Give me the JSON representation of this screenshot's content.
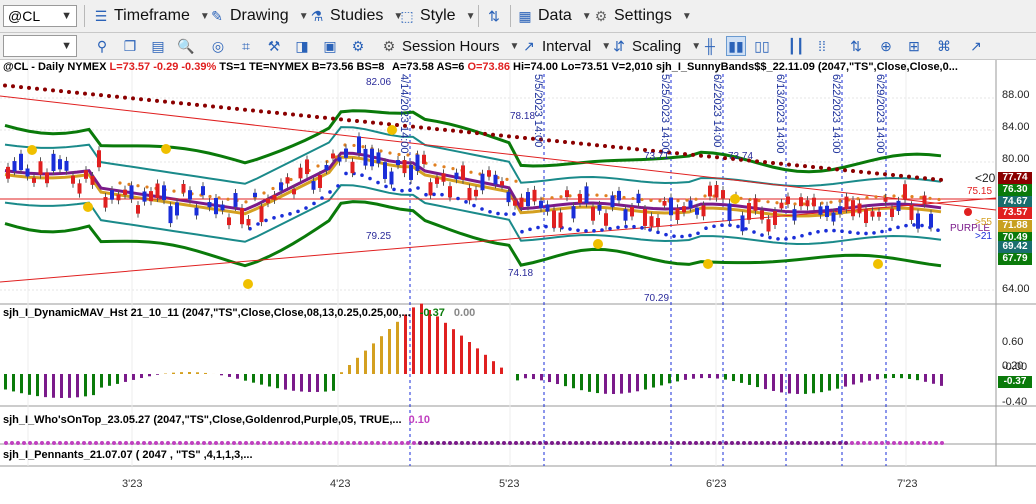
{
  "toolbar1": {
    "symbol": "@CL",
    "timeframe": "Timeframe",
    "drawing": "Drawing",
    "studies": "Studies",
    "style": "Style",
    "data": "Data",
    "settings": "Settings"
  },
  "toolbar2": {
    "combo_value": "",
    "session_hours": "Session Hours",
    "interval": "Interval",
    "scaling": "Scaling"
  },
  "header": {
    "symbol_line": "@CL - Daily  NYMEX",
    "L": "L=73.57",
    "chg": "-0.29",
    "pct": "-0.39%",
    "rest1": "TS=1  TE=NYMEX  B=73.56  BS=8",
    "rest2": "A=73.58  AS=6",
    "O": "O=73.86",
    "rest3": "Hi=74.00  Lo=73.51  V=2,010",
    "study": "sjh_I_SunnyBands$$_22.11.09 (2047,\"TS\",Close,Close,0..."
  },
  "annotations": {
    "v1": "4/14/2023 14:00",
    "v2": "5/5/2023 14:00",
    "v3": "5/25/2023 14:00",
    "v4": "6/2/2023 14:00",
    "v5": "6/13/2023 14:00",
    "v6": "6/22/2023 14:00",
    "v7": "6/29/2023 14:00",
    "p1": "82.06",
    "p2": "78.18",
    "p3": "73.71",
    "p4": "73.74",
    "p5": "79.25",
    "p6": "74.18",
    "p7": "70.29"
  },
  "price_scale": [
    "88.00",
    "84.00",
    "80.00",
    "64.00"
  ],
  "tags": [
    {
      "text": "77.74",
      "color": "#8b0000"
    },
    {
      "text": "76.30",
      "color": "#0a7a0a"
    },
    {
      "text": "74.67",
      "color": "#1a6e6e"
    },
    {
      "text": "73.57",
      "color": "#e02020"
    },
    {
      "text": "71.88",
      "color": "#c8a020"
    },
    {
      "text": "70.49",
      "color": "#0a7a0a"
    },
    {
      "text": "69.42",
      "color": "#1a6e6e"
    },
    {
      "text": "67.79",
      "color": "#0a7a0a"
    }
  ],
  "side": {
    "lt20": "<20",
    "v7515": "75.15",
    "purple": "PURPLE",
    "gt55": ">55",
    "gt21": ">21"
  },
  "indicator1": {
    "title": "sjh_I_DynamicMAV_Hst 21_10_11 (2047,\"TS\",Close,Close,08,13,0.25,0.25,00,...",
    "val1": "-0.37",
    "val2": "0.00",
    "scale": [
      "0.60",
      "0.20",
      "-0.00",
      "-0.40"
    ],
    "tag": "-0.37"
  },
  "indicator2": {
    "title": "sjh_I_Who'sOnTop_23.05.27 (2047,\"TS\",Close,Goldenrod,Purple,05,  TRUE,...",
    "val": "0.10"
  },
  "indicator3": {
    "title": "sjh_I_Pennants_21.07.07 ( 2047 , \"TS\" ,4,1,1,3,..."
  },
  "x_axis": [
    "3'23",
    "4'23",
    "5'23",
    "6'23",
    "7'23"
  ],
  "colors": {
    "band_green": "#0a7a0a",
    "band_teal": "#1a8a8a",
    "purple": "#7a1a8a",
    "gold": "#d4a020",
    "up_bar": "#1a2ed8",
    "down_bar": "#e02020",
    "dots_dark": "#8b0000",
    "dots_blue": "#1a2ed8"
  },
  "icons": [
    "timeframe-icon",
    "drawing-icon",
    "studies-icon",
    "style-icon",
    "data-icon",
    "settings-icon"
  ]
}
